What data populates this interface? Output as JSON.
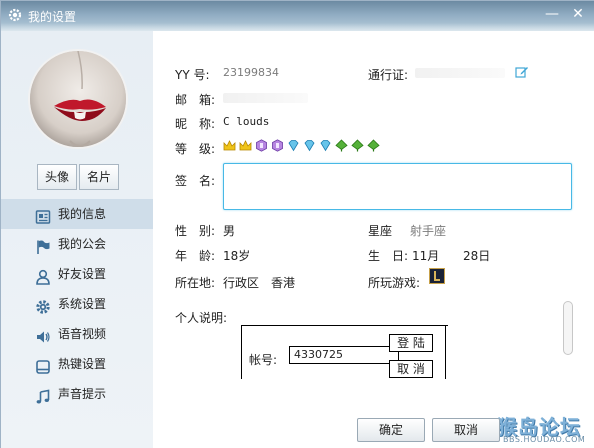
{
  "window": {
    "title": "我的设置",
    "minimize_glyph": "—",
    "close_glyph": "✕"
  },
  "sidebar": {
    "avatar_button": "头像",
    "card_button": "名片",
    "items": [
      {
        "label": "我的信息",
        "icon": "profile-card-icon",
        "active": true
      },
      {
        "label": "我的公会",
        "icon": "guild-flag-icon",
        "active": false
      },
      {
        "label": "好友设置",
        "icon": "friend-person-icon",
        "active": false
      },
      {
        "label": "系统设置",
        "icon": "gear-icon",
        "active": false
      },
      {
        "label": "语音视频",
        "icon": "speaker-icon",
        "active": false
      },
      {
        "label": "热键设置",
        "icon": "keyboard-icon",
        "active": false
      },
      {
        "label": "声音提示",
        "icon": "music-note-icon",
        "active": false
      }
    ]
  },
  "profile": {
    "yy_label": "YY 号:",
    "yy_value": "23199834",
    "passport_label": "通行证:",
    "email_label": "邮　箱:",
    "nickname_label": "昵　称:",
    "nickname_value": "C louds",
    "level_label": "等　级:",
    "level_badges": [
      "crown-icon",
      "crown-icon",
      "purple-gem-icon",
      "purple-gem-icon",
      "blue-diamond-icon",
      "blue-diamond-icon",
      "blue-diamond-icon",
      "green-tree-icon",
      "green-tree-icon",
      "green-tree-icon"
    ],
    "signature_label": "签　名:",
    "signature_value": "",
    "gender_label": "性　别:",
    "gender_value": "男",
    "constellation_label": "星座",
    "constellation_value": "射手座",
    "age_label": "年　龄:",
    "age_value": "18岁",
    "birthday_label": "生　日:",
    "birthday_month": "11月",
    "birthday_day": "28日",
    "location_label": "所在地:",
    "location_value": "行政区　香港",
    "games_label": "所玩游戏:",
    "bio_label": "个人说明:"
  },
  "embedded_login": {
    "account_label": "帐号:",
    "account_value": "4330725",
    "login_button": "登 陆",
    "cancel_button": "取 消"
  },
  "footer": {
    "ok_button": "确定",
    "cancel_button": "取消"
  },
  "watermark": {
    "main": "猴岛论坛",
    "sub": "BBS.HOUDAO.COM"
  },
  "colors": {
    "titlebar": "#7f9db5",
    "sidebar_bg": "#eaf0f5",
    "nav_active": "#cfdde9",
    "signature_border": "#48b9e6",
    "icon_blue": "#3e6f98"
  }
}
